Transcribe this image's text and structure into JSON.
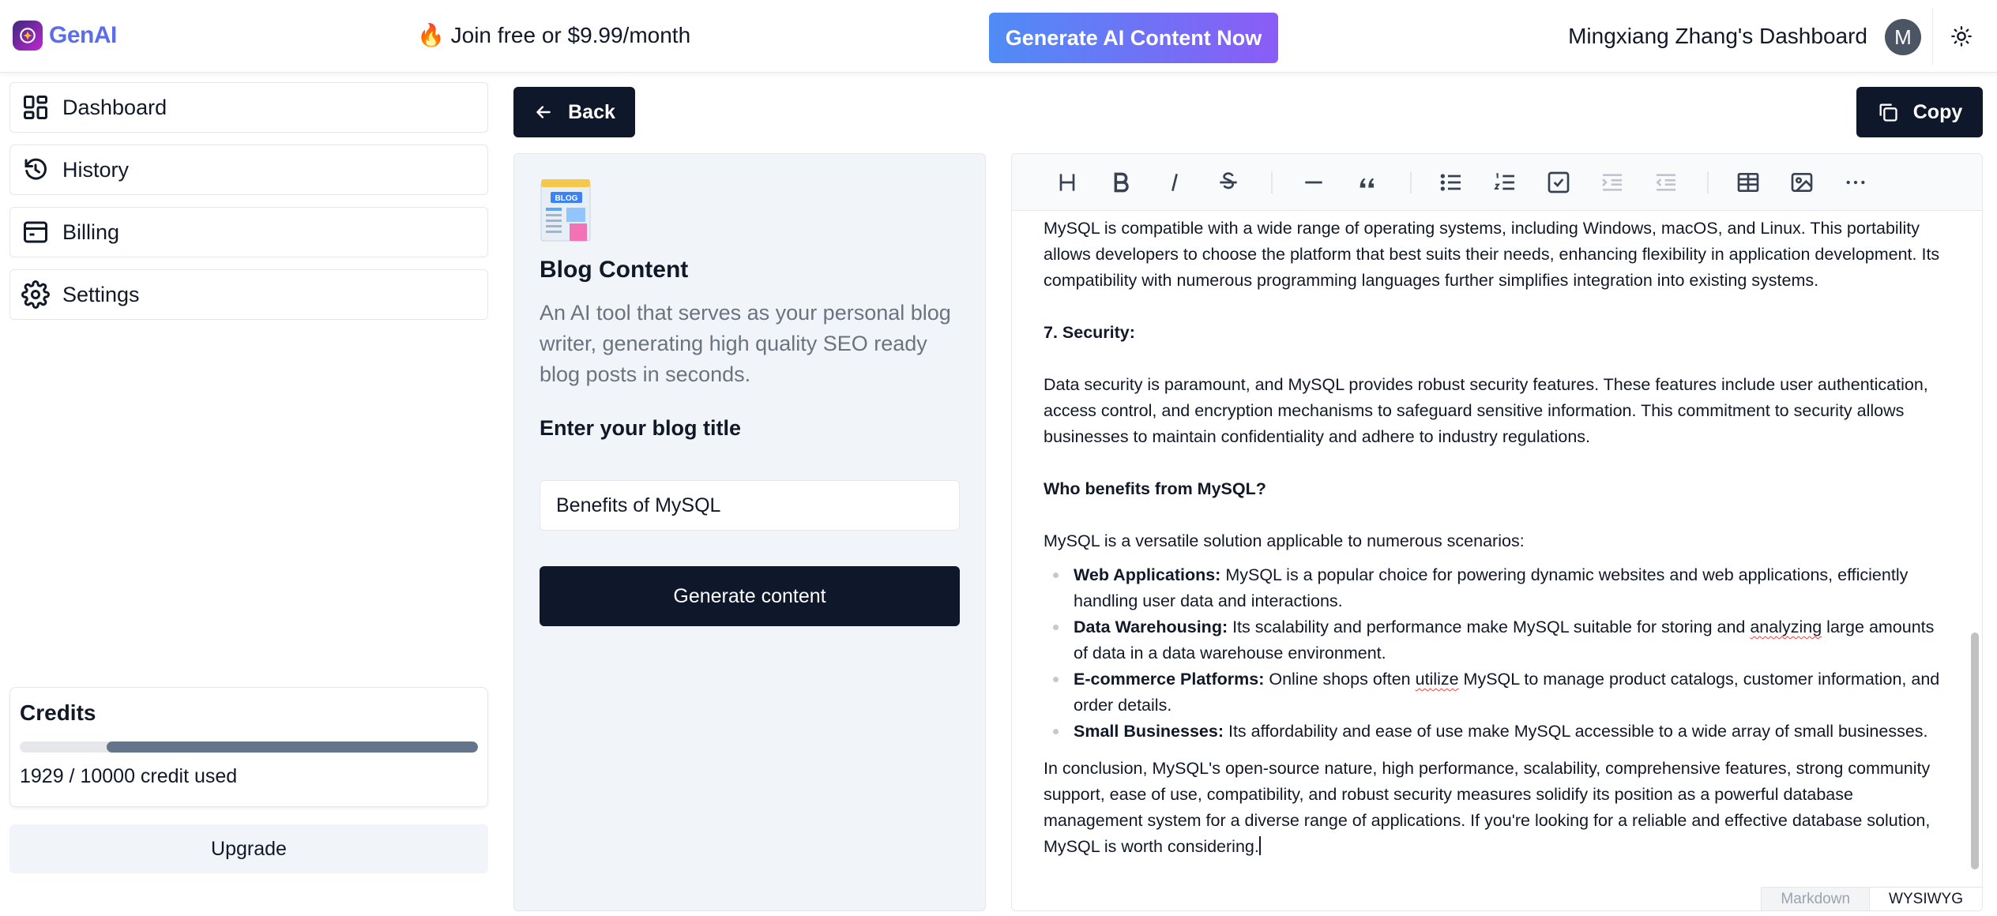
{
  "header": {
    "logo_text": "GenAI",
    "promo": "🔥 Join free or $9.99/month",
    "cta_label": "Generate AI Content Now",
    "user_title": "Mingxiang Zhang's Dashboard",
    "avatar_initial": "M"
  },
  "sidebar": {
    "items": [
      {
        "label": "Dashboard",
        "icon": "dashboard-icon"
      },
      {
        "label": "History",
        "icon": "history-icon"
      },
      {
        "label": "Billing",
        "icon": "billing-icon"
      },
      {
        "label": "Settings",
        "icon": "settings-icon"
      }
    ],
    "credits": {
      "title": "Credits",
      "used": 1929,
      "total": 10000,
      "text": "1929 / 10000 credit used",
      "bar_fill_fraction": 0.81
    },
    "upgrade_label": "Upgrade"
  },
  "actions": {
    "back_label": "Back",
    "copy_label": "Copy"
  },
  "form": {
    "icon": "blog-icon",
    "title": "Blog Content",
    "description": "An AI tool that serves as your personal blog writer, generating high quality SEO ready blog posts in seconds.",
    "label": "Enter your blog title",
    "input_value": "Benefits of MySQL",
    "submit_label": "Generate content"
  },
  "editor": {
    "toolbar": [
      "heading-icon",
      "bold-icon",
      "italic-icon",
      "strikethrough-icon",
      "horizontal-rule-icon",
      "blockquote-icon",
      "bullet-list-icon",
      "ordered-list-icon",
      "task-list-icon",
      "indent-icon",
      "outdent-icon",
      "table-icon",
      "image-icon",
      "more-icon"
    ],
    "para_compat": "MySQL is compatible with a wide range of operating systems, including Windows, macOS, and Linux. This portability allows developers to choose the platform that best suits their needs, enhancing flexibility in application development. Its compatibility with numerous programming languages further simplifies integration into existing systems.",
    "heading_security": "7. Security:",
    "para_security": "Data security is paramount, and MySQL provides robust security features. These features include user authentication, access control, and encryption mechanisms to safeguard sensitive information. This commitment to security allows businesses to maintain confidentiality and adhere to industry regulations.",
    "heading_who": "Who benefits from MySQL?",
    "para_versatile": "MySQL is a versatile solution applicable to numerous scenarios:",
    "list": [
      {
        "term": "Web Applications:",
        "pre": " MySQL is a popular choice for powering dynamic websites and web applications, efficiently handling user data and interactions.",
        "spell": "",
        "post": ""
      },
      {
        "term": "Data Warehousing:",
        "pre": " Its scalability and performance make MySQL suitable for storing and ",
        "spell": "analyzing",
        "post": " large amounts of data in a data warehouse environment."
      },
      {
        "term": "E-commerce Platforms:",
        "pre": " Online shops often ",
        "spell": "utilize",
        "post": " MySQL to manage product catalogs, customer information, and order details."
      },
      {
        "term": "Small Businesses:",
        "pre": " Its affordability and ease of use make MySQL accessible to a wide array of small businesses.",
        "spell": "",
        "post": ""
      }
    ],
    "para_conclusion": "In conclusion, MySQL's open-source nature, high performance, scalability, comprehensive features, strong community support, ease of use, compatibility, and robust security measures solidify its position as a powerful database management system for a diverse range of applications. If you're looking for a reliable and effective database solution, MySQL is worth considering.",
    "modes": [
      "Markdown",
      "WYSIWYG"
    ],
    "active_mode": "WYSIWYG"
  }
}
